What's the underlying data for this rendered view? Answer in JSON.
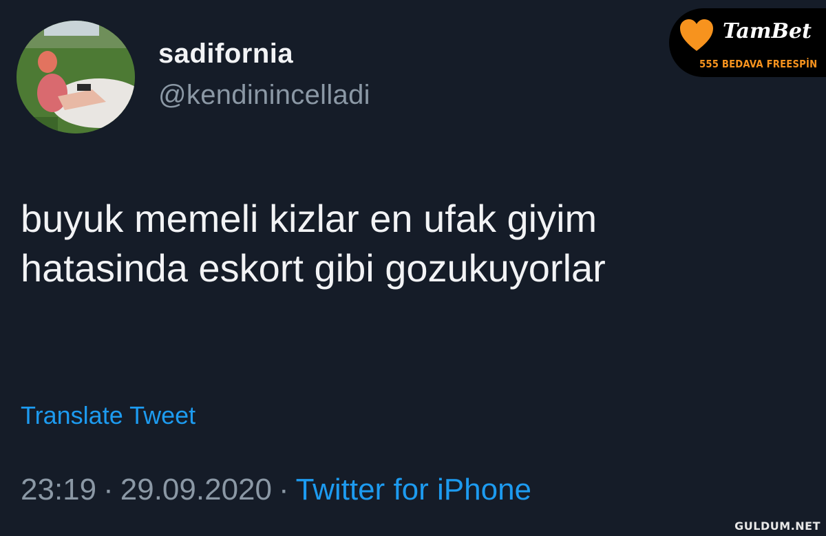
{
  "tweet": {
    "display_name": "sadifornia",
    "handle": "@kendinincelladi",
    "text": "buyuk memeli kizlar en ufak giyim\nhatasinda eskort gibi gozukuyorlar",
    "translate_label": "Translate Tweet",
    "time": "23:19",
    "date": "29.09.2020",
    "separator": "·",
    "source": "Twitter for iPhone"
  },
  "promo": {
    "brand": "TamBet",
    "text": "555 BEDAVA FREESPİN",
    "icon": "heart-icon"
  },
  "watermark": "GULDUM.NET",
  "colors": {
    "background": "#151c28",
    "link": "#1d9bf0",
    "muted": "#8b98a5",
    "promo_accent": "#f7931e"
  }
}
